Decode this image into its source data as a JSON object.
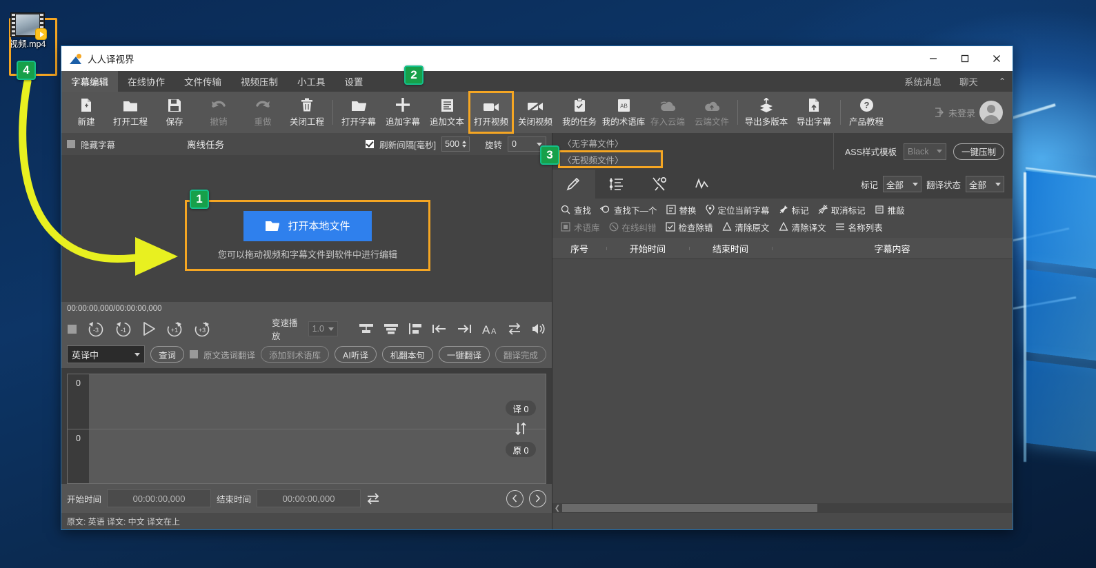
{
  "desktop": {
    "icon": {
      "label": "视频.mp4",
      "name": "video-file-icon"
    }
  },
  "annotations": {
    "badges": [
      {
        "num": "1"
      },
      {
        "num": "2"
      },
      {
        "num": "3"
      },
      {
        "num": "4"
      }
    ]
  },
  "window": {
    "title": "人人译视界",
    "controls": {
      "minimize": "minimize",
      "maximize": "maximize",
      "close": "close"
    }
  },
  "tabs": {
    "items": [
      {
        "label": "字幕编辑",
        "active": true
      },
      {
        "label": "在线协作",
        "active": false
      },
      {
        "label": "文件传输",
        "active": false
      },
      {
        "label": "视频压制",
        "active": false
      },
      {
        "label": "小工具",
        "active": false
      },
      {
        "label": "设置",
        "active": false
      }
    ],
    "right_links": [
      {
        "label": "系统消息"
      },
      {
        "label": "聊天"
      }
    ],
    "collapse": "⌃"
  },
  "toolbar": {
    "buttons": [
      {
        "label": "新建",
        "icon": "new-file-icon",
        "dim": false
      },
      {
        "label": "打开工程",
        "icon": "open-project-icon",
        "dim": false
      },
      {
        "label": "保存",
        "icon": "save-icon",
        "dim": false
      },
      {
        "label": "撤销",
        "icon": "undo-icon",
        "dim": true
      },
      {
        "label": "重做",
        "icon": "redo-icon",
        "dim": true
      },
      {
        "label": "关闭工程",
        "icon": "trash-icon",
        "dim": false
      },
      {
        "label": "打开字幕",
        "icon": "open-subtitle-icon",
        "dim": false
      },
      {
        "label": "追加字幕",
        "icon": "add-subtitle-icon",
        "dim": false
      },
      {
        "label": "追加文本",
        "icon": "add-text-icon",
        "dim": false
      },
      {
        "label": "打开视频",
        "icon": "open-video-icon",
        "dim": false,
        "highlight": true
      },
      {
        "label": "关闭视频",
        "icon": "close-video-icon",
        "dim": false
      },
      {
        "label": "我的任务",
        "icon": "my-tasks-icon",
        "dim": false
      },
      {
        "label": "我的术语库",
        "icon": "my-glossary-icon",
        "dim": false
      },
      {
        "label": "存入云端",
        "icon": "save-cloud-icon",
        "dim": true
      },
      {
        "label": "云端文件",
        "icon": "cloud-files-icon",
        "dim": true
      },
      {
        "label": "导出多版本",
        "icon": "export-multi-icon",
        "dim": false
      },
      {
        "label": "导出字幕",
        "icon": "export-subtitle-icon",
        "dim": false
      },
      {
        "label": "产品教程",
        "icon": "help-icon",
        "dim": false
      }
    ],
    "login_label": "未登录"
  },
  "options_bar": {
    "hide_subtitle_label": "隐藏字幕",
    "hide_subtitle_checked": false,
    "offline_task_label": "离线任务",
    "refresh_label": "刷新间隔[毫秒]",
    "refresh_checked": true,
    "refresh_value": "500",
    "rotate_label": "旋转",
    "rotate_value": "0"
  },
  "preview": {
    "open_local_button": "打开本地文件",
    "hint": "您可以拖动视频和字幕文件到软件中进行编辑"
  },
  "media": {
    "timecode": "00:00:00,000/00:00:00,000",
    "speed_label": "变速播放",
    "speed_value": "1.0",
    "buttons": [
      {
        "name": "stop-button"
      },
      {
        "name": "rewind-3s-button",
        "label": "-3"
      },
      {
        "name": "rewind-1s-button",
        "label": "-1"
      },
      {
        "name": "play-button"
      },
      {
        "name": "forward-1s-button",
        "label": "+1"
      },
      {
        "name": "forward-3s-button",
        "label": "+3"
      }
    ],
    "tools": [
      {
        "name": "align-rows-icon"
      },
      {
        "name": "merge-rows-icon"
      },
      {
        "name": "align-left-icon"
      },
      {
        "name": "set-start-icon"
      },
      {
        "name": "set-end-icon"
      },
      {
        "name": "font-size-icon"
      },
      {
        "name": "swap-icon"
      },
      {
        "name": "volume-icon"
      }
    ]
  },
  "translate_bar": {
    "lang_value": "英译中",
    "query_button": "查词",
    "orig_select_label": "原文选词翻译",
    "orig_select_checked": false,
    "pills": [
      {
        "label": "添加到术语库",
        "dim": true
      },
      {
        "label": "AI听译",
        "dim": false
      },
      {
        "label": "机翻本句",
        "dim": false
      },
      {
        "label": "一键翻译",
        "dim": false
      },
      {
        "label": "翻译完成",
        "dim": true
      }
    ]
  },
  "edit_area": {
    "line_numbers": [
      "0",
      "0"
    ],
    "tag_translated": "译 0",
    "tag_original": "原 0",
    "swap_icon": "swap-vertical-icon"
  },
  "time_row": {
    "start_label": "开始时间",
    "start_value": "00:00:00,000",
    "end_label": "结束时间",
    "end_value": "00:00:00,000",
    "sync_icon": "sync-icon",
    "prev_icon": "prev-icon",
    "next_icon": "next-icon"
  },
  "status_bar": {
    "text": "原文: 英语 译文: 中文   译文在上"
  },
  "right_panel": {
    "subtitle_file": "〈无字幕文件〉",
    "video_file": "〈无视频文件〉",
    "ass_label": "ASS样式模板",
    "ass_value": "Black",
    "compress_button": "一键压制",
    "tabs": [
      {
        "name": "edit-tab",
        "active": true
      },
      {
        "name": "timeline-tab",
        "active": false
      },
      {
        "name": "tools-tab",
        "active": false
      },
      {
        "name": "waveform-tab",
        "active": false
      }
    ],
    "filters": [
      {
        "label": "标记",
        "value": "全部"
      },
      {
        "label": "翻译状态",
        "value": "全部"
      }
    ],
    "tools_row1": [
      {
        "label": "查找",
        "icon": "search-icon",
        "dim": false
      },
      {
        "label": "查找下—个",
        "icon": "find-next-icon",
        "dim": false
      },
      {
        "label": "替换",
        "icon": "replace-icon",
        "dim": false
      },
      {
        "label": "定位当前字幕",
        "icon": "locate-icon",
        "dim": false
      },
      {
        "label": "标记",
        "icon": "pin-icon",
        "dim": false
      },
      {
        "label": "取消标记",
        "icon": "unpin-icon",
        "dim": false
      },
      {
        "label": "推敲",
        "icon": "polish-icon",
        "dim": false
      }
    ],
    "tools_row2": [
      {
        "label": "术语库",
        "icon": "glossary-icon",
        "dim": true
      },
      {
        "label": "在线纠错",
        "icon": "online-fix-icon",
        "dim": true
      },
      {
        "label": "检查除错",
        "icon": "check-errors-icon",
        "dim": false
      },
      {
        "label": "清除原文",
        "icon": "clear-original-icon",
        "dim": false
      },
      {
        "label": "清除译文",
        "icon": "clear-translation-icon",
        "dim": false
      },
      {
        "label": "名称列表",
        "icon": "name-list-icon",
        "dim": false
      }
    ],
    "table": {
      "columns": [
        "序号",
        "开始时间",
        "结束时间",
        "字幕内容"
      ],
      "rows": []
    }
  },
  "colors": {
    "accent_blue": "#2F80ED",
    "highlight_orange": "#F5A623",
    "badge_green": "#17A04A",
    "arrow_yellow": "#E8F020"
  }
}
